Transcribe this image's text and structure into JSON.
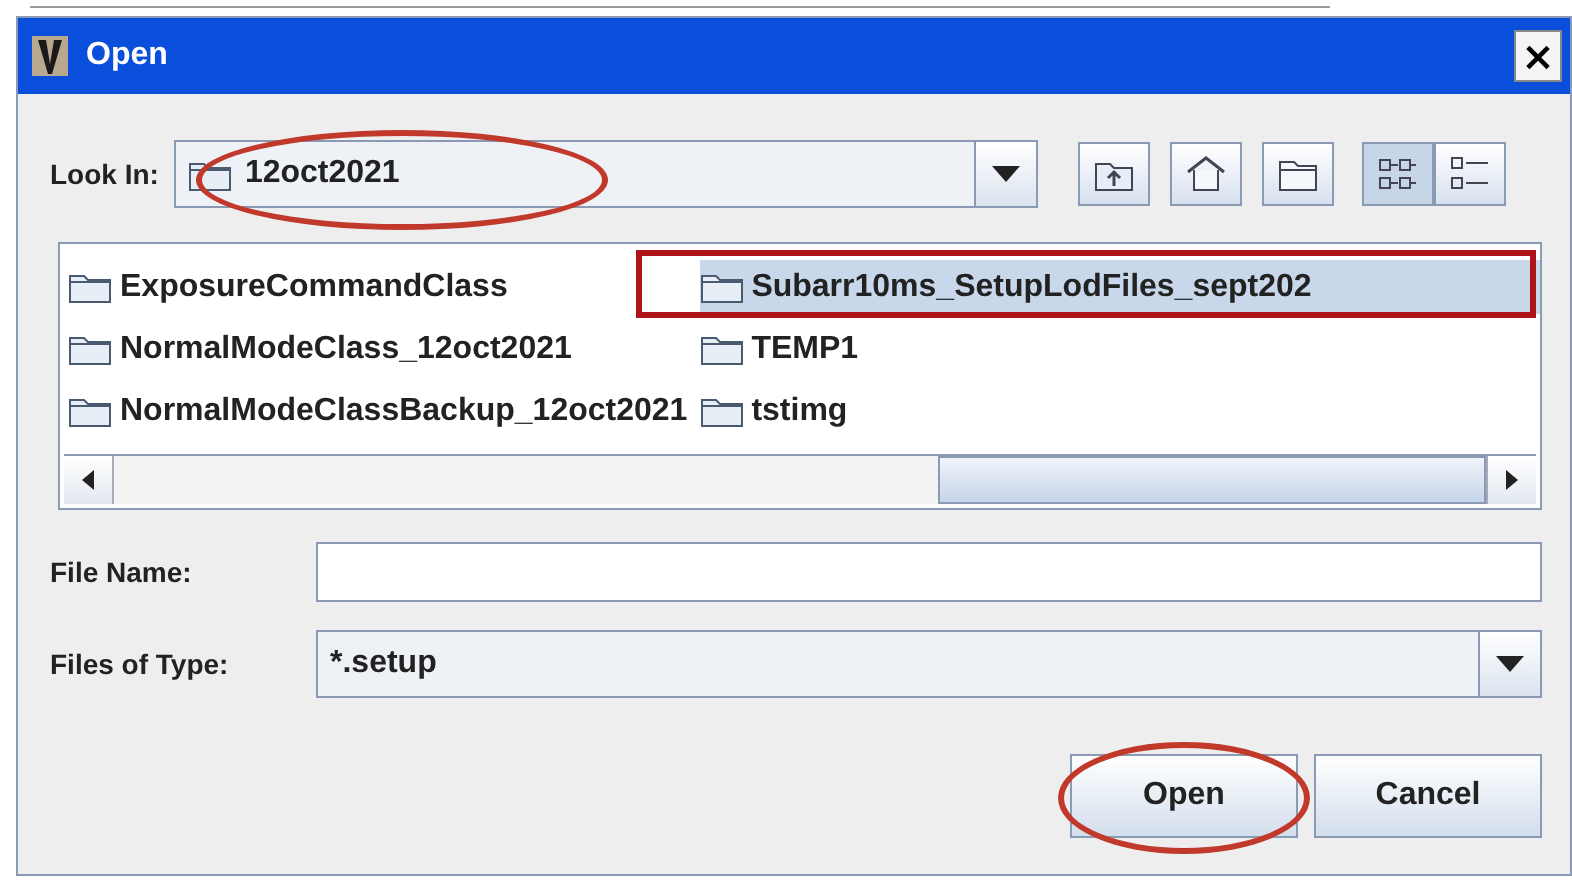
{
  "window": {
    "title": "Open",
    "close": "×"
  },
  "look_in": {
    "label": "Look In:",
    "value": "12oct2021",
    "circled": true
  },
  "toolbar": [
    {
      "kind": "up"
    },
    {
      "kind": "home"
    },
    {
      "kind": "new-folder"
    },
    {
      "kind": "list",
      "selected": true
    },
    {
      "kind": "details",
      "selected": false
    }
  ],
  "files": [
    {
      "name": "ExposureCommandClass",
      "selected": false,
      "boxed": false
    },
    {
      "name": "NormalModeClass_12oct2021",
      "selected": false,
      "boxed": false
    },
    {
      "name": "NormalModeClassBackup_12oct2021",
      "selected": false,
      "boxed": false
    },
    {
      "name": "Subarr10ms_SetupLodFiles_sept202",
      "selected": true,
      "boxed": true
    },
    {
      "name": "TEMP1",
      "selected": false,
      "boxed": false
    },
    {
      "name": "tstimg",
      "selected": false,
      "boxed": false
    }
  ],
  "file_name": {
    "label": "File Name:"
  },
  "file_type": {
    "label": "Files of Type:",
    "value": "*.setup"
  },
  "buttons": [
    {
      "label": "Open",
      "circled": true
    },
    {
      "label": "Cancel",
      "circled": false
    }
  ]
}
